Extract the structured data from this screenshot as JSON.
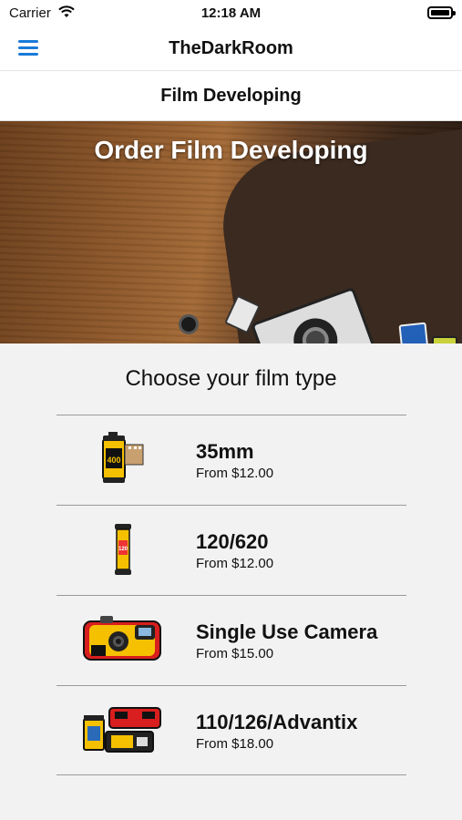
{
  "status_bar": {
    "carrier": "Carrier",
    "time": "12:18 AM"
  },
  "navbar": {
    "title": "TheDarkRoom",
    "menu_icon": "hamburger-menu-icon"
  },
  "subheader": {
    "title": "Film Developing"
  },
  "hero": {
    "title": "Order Film Developing",
    "image": "film-cameras-on-wood-photo"
  },
  "section": {
    "title": "Choose your film type"
  },
  "film_types": [
    {
      "name": "35mm",
      "price": "From $12.00",
      "icon": "35mm-canister-icon"
    },
    {
      "name": "120/620",
      "price": "From $12.00",
      "icon": "120-roll-icon"
    },
    {
      "name": "Single Use Camera",
      "price": "From $15.00",
      "icon": "disposable-camera-icon"
    },
    {
      "name": "110/126/Advantix",
      "price": "From $18.00",
      "icon": "cartridges-icon"
    }
  ],
  "colors": {
    "accent": "#1a7ad9",
    "background": "#f2f2f2",
    "film_yellow": "#f5c000",
    "film_red": "#d81e1e"
  }
}
